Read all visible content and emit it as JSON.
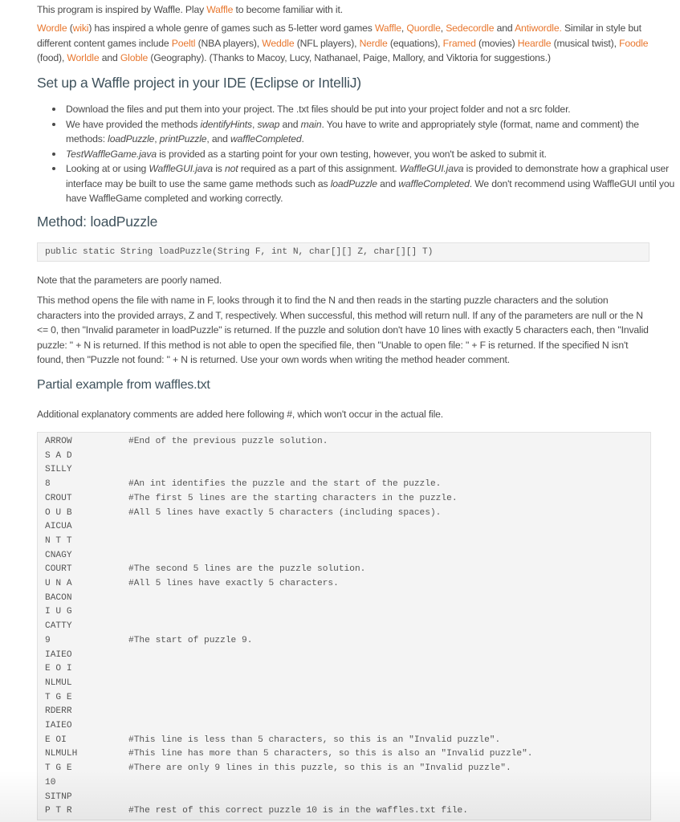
{
  "intro": {
    "before": "This program is inspired by Waffle. Play ",
    "link": "Waffle",
    "after": " to become familiar with it."
  },
  "genre_paragraph": {
    "parts": [
      {
        "type": "link",
        "text": "Wordle"
      },
      {
        "type": "text",
        "text": " ("
      },
      {
        "type": "link",
        "text": "wiki"
      },
      {
        "type": "text",
        "text": ") has inspired a whole genre of games such as 5-letter word games "
      },
      {
        "type": "link",
        "text": "Waffle"
      },
      {
        "type": "text",
        "text": ", "
      },
      {
        "type": "link",
        "text": "Quordle"
      },
      {
        "type": "text",
        "text": ", "
      },
      {
        "type": "link",
        "text": "Sedecordle"
      },
      {
        "type": "text",
        "text": " and "
      },
      {
        "type": "link",
        "text": "Antiwordle."
      },
      {
        "type": "text",
        "text": " Similar in style but different content games include "
      },
      {
        "type": "link",
        "text": "Poeltl"
      },
      {
        "type": "text",
        "text": " (NBA players), "
      },
      {
        "type": "link",
        "text": "Weddle"
      },
      {
        "type": "text",
        "text": " (NFL players), "
      },
      {
        "type": "link",
        "text": "Nerdle"
      },
      {
        "type": "text",
        "text": " (equations), "
      },
      {
        "type": "link",
        "text": "Framed"
      },
      {
        "type": "text",
        "text": " (movies) "
      },
      {
        "type": "link",
        "text": "Heardle"
      },
      {
        "type": "text",
        "text": " (musical twist), "
      },
      {
        "type": "link",
        "text": "Foodle"
      },
      {
        "type": "text",
        "text": " (food), "
      },
      {
        "type": "link",
        "text": "Worldle"
      },
      {
        "type": "text",
        "text": " and "
      },
      {
        "type": "link",
        "text": "Globle"
      },
      {
        "type": "text",
        "text": " (Geography). (Thanks to Macoy, Lucy, Nathanael, Paige, Mallory, and Viktoria for suggestions.)"
      }
    ]
  },
  "setup": {
    "heading": "Set up a Waffle project in your IDE (Eclipse or IntelliJ)",
    "bullets": [
      [
        {
          "type": "text",
          "text": "Download the files and put them into your project. The .txt files should be put into your project folder and not a src folder."
        }
      ],
      [
        {
          "type": "text",
          "text": "We have provided the methods "
        },
        {
          "type": "em",
          "text": "identifyHints"
        },
        {
          "type": "text",
          "text": ", "
        },
        {
          "type": "em",
          "text": "swap"
        },
        {
          "type": "text",
          "text": " and "
        },
        {
          "type": "em",
          "text": "main"
        },
        {
          "type": "text",
          "text": ". You have to write and appropriately style (format, name and comment) the methods: "
        },
        {
          "type": "em",
          "text": "loadPuzzle"
        },
        {
          "type": "text",
          "text": ", "
        },
        {
          "type": "em",
          "text": "printPuzzle"
        },
        {
          "type": "text",
          "text": ", and "
        },
        {
          "type": "em",
          "text": "waffleCompleted"
        },
        {
          "type": "text",
          "text": "."
        }
      ],
      [
        {
          "type": "em",
          "text": "TestWaffleGame.java"
        },
        {
          "type": "text",
          "text": " is provided as a starting point for your own testing, however, you won't be asked to submit it."
        }
      ],
      [
        {
          "type": "text",
          "text": "Looking at or using "
        },
        {
          "type": "em",
          "text": "WaffleGUI.java"
        },
        {
          "type": "text",
          "text": " is "
        },
        {
          "type": "em",
          "text": "not"
        },
        {
          "type": "text",
          "text": " required as a part of this assignment. "
        },
        {
          "type": "em",
          "text": "WaffleGUI.java"
        },
        {
          "type": "text",
          "text": " is provided to demonstrate how a graphical user interface may be built to use the same game methods such as "
        },
        {
          "type": "em",
          "text": "loadPuzzle"
        },
        {
          "type": "text",
          "text": " and "
        },
        {
          "type": "em",
          "text": "waffleCompleted"
        },
        {
          "type": "text",
          "text": ". We don't recommend using WaffleGUI until you have WaffleGame completed and working correctly."
        }
      ]
    ]
  },
  "method": {
    "heading": "Method: loadPuzzle",
    "signature": "public static String loadPuzzle(String F, int N, char[][] Z, char[][] T)",
    "note": "Note that the parameters are poorly named.",
    "description": "This method opens the file with name in F, looks through it to find the N and then reads in the starting puzzle characters and the solution characters into the provided arrays, Z and T, respectively. When successful, this method will return null. If any of the parameters are null or the N <= 0, then \"Invalid parameter in loadPuzzle\" is returned. If the puzzle and solution don't have 10 lines with exactly 5 characters each, then \"Invalid puzzle: \" + N is returned. If this method is not able to open the specified file, then \"Unable to open file: \" + F is returned. If the specified N isn't found, then \"Puzzle not found: \" + N is returned. Use your own words when writing the method header comment."
  },
  "partial": {
    "heading": "Partial example from waffles.txt",
    "explanation": "Additional explanatory comments are added here following #, which won't occur in the actual file.",
    "lines": [
      {
        "value": "ARROW",
        "comment": "#End of the previous puzzle solution."
      },
      {
        "value": "S A D",
        "comment": ""
      },
      {
        "value": "SILLY",
        "comment": ""
      },
      {
        "value": "8",
        "comment": "#An int identifies the puzzle and the start of the puzzle."
      },
      {
        "value": "CROUT",
        "comment": "#The first 5 lines are the starting characters in the puzzle."
      },
      {
        "value": "O U B",
        "comment": "#All 5 lines have exactly 5 characters (including spaces)."
      },
      {
        "value": "AICUA",
        "comment": ""
      },
      {
        "value": "N T T",
        "comment": ""
      },
      {
        "value": "CNAGY",
        "comment": ""
      },
      {
        "value": "COURT",
        "comment": "#The second 5 lines are the puzzle solution."
      },
      {
        "value": "U N A",
        "comment": "#All 5 lines have exactly 5 characters."
      },
      {
        "value": "BACON",
        "comment": ""
      },
      {
        "value": "I U G",
        "comment": ""
      },
      {
        "value": "CATTY",
        "comment": ""
      },
      {
        "value": "9",
        "comment": "#The start of puzzle 9."
      },
      {
        "value": "IAIEO",
        "comment": ""
      },
      {
        "value": "E O I",
        "comment": ""
      },
      {
        "value": "NLMUL",
        "comment": ""
      },
      {
        "value": "T G E",
        "comment": ""
      },
      {
        "value": "RDERR",
        "comment": ""
      },
      {
        "value": "IAIEO",
        "comment": ""
      },
      {
        "value": "E OI",
        "comment": "#This line is less than 5 characters, so this is an \"Invalid puzzle\"."
      },
      {
        "value": "NLMULH",
        "comment": "#This line has more than 5 characters, so this is also an \"Invalid puzzle\"."
      },
      {
        "value": "T G E",
        "comment": "#There are only 9 lines in this puzzle, so this is an \"Invalid puzzle\"."
      },
      {
        "value": "10",
        "comment": ""
      },
      {
        "value": "SITNP",
        "comment": ""
      },
      {
        "value": "P T R",
        "comment": "#The rest of this correct puzzle 10 is in the waffles.txt file."
      }
    ]
  },
  "colors": {
    "link": "#e8772e",
    "heading": "#3f525c",
    "body_text": "#4a4a4a",
    "code_bg": "#f4f4f4",
    "code_border": "#e2e2e2"
  }
}
